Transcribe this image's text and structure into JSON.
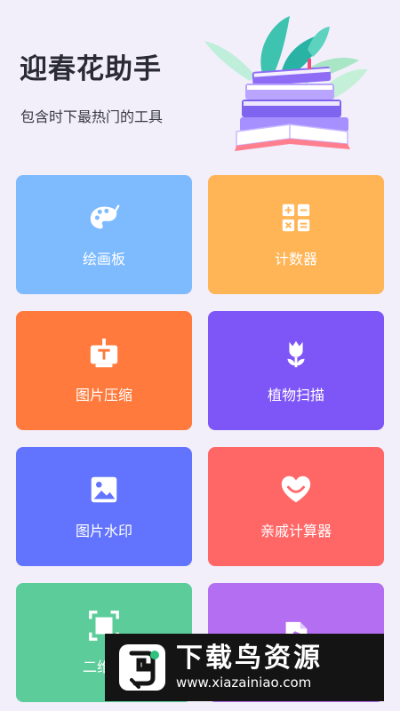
{
  "header": {
    "title": "迎春花助手",
    "subtitle": "包含时下最热门的工具"
  },
  "tools": [
    {
      "label": "绘画板",
      "icon": "palette-icon",
      "color": "#7dbafe"
    },
    {
      "label": "计数器",
      "icon": "calculator-icon",
      "color": "#ffb455"
    },
    {
      "label": "图片压缩",
      "icon": "image-compress-icon",
      "color": "#ff7a3c"
    },
    {
      "label": "植物扫描",
      "icon": "flower-icon",
      "color": "#7e55f6"
    },
    {
      "label": "图片水印",
      "icon": "picture-icon",
      "color": "#6274fd"
    },
    {
      "label": "亲戚计算器",
      "icon": "heart-smile-icon",
      "color": "#ff6767"
    },
    {
      "label": "二维码",
      "icon": "qr-scan-icon",
      "color": "#5ccd9a"
    },
    {
      "label": "",
      "icon": "music-file-icon",
      "color": "#b46ef2"
    }
  ],
  "watermark": {
    "title": "下载鸟资源",
    "url": "www.xiazainiao.com"
  }
}
